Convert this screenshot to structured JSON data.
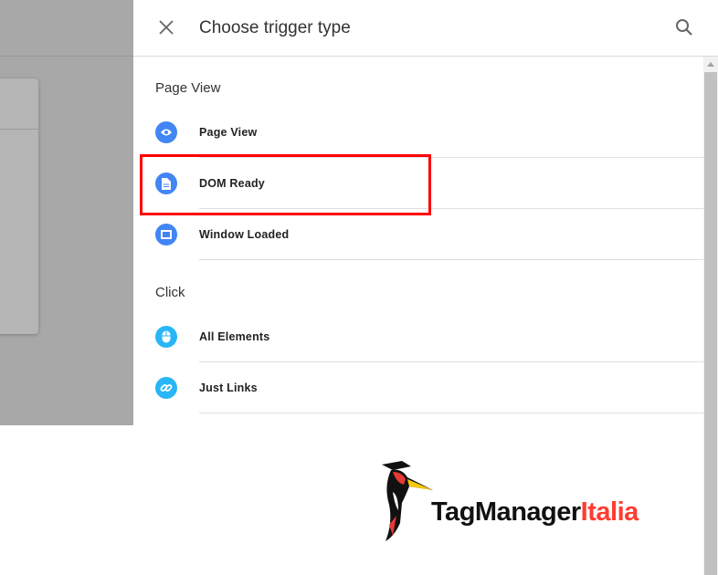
{
  "header": {
    "title": "Choose trigger type",
    "close_icon": "close-icon",
    "search_icon": "search-icon"
  },
  "sections": [
    {
      "title": "Page View",
      "items": [
        {
          "label": "Page View",
          "icon": "eye-icon",
          "color": "#4285f4"
        },
        {
          "label": "DOM Ready",
          "icon": "document-icon",
          "color": "#4285f4"
        },
        {
          "label": "Window Loaded",
          "icon": "window-icon",
          "color": "#4285f4"
        }
      ]
    },
    {
      "title": "Click",
      "items": [
        {
          "label": "All Elements",
          "icon": "mouse-icon",
          "color": "#29b6f6"
        },
        {
          "label": "Just Links",
          "icon": "link-icon",
          "color": "#29b6f6"
        }
      ]
    }
  ],
  "highlight_color": "#ff0000",
  "watermark": {
    "text_main": "TagManager",
    "text_accent": "Italia",
    "accent_color": "#ff3b2f"
  }
}
